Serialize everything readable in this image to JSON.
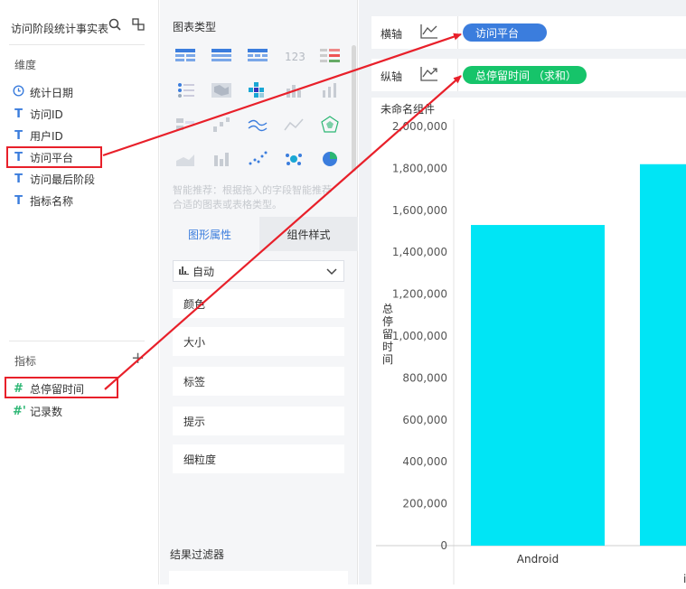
{
  "left_panel": {
    "dataset_name": "访问阶段统计事实表",
    "dimension_section": "维度",
    "dimension_fields": [
      {
        "icon": "clock",
        "label": "统计日期"
      },
      {
        "icon": "T",
        "label": "访问ID"
      },
      {
        "icon": "T",
        "label": "用户ID"
      },
      {
        "icon": "T",
        "label": "访问平台"
      },
      {
        "icon": "T",
        "label": "访问最后阶段"
      },
      {
        "icon": "T",
        "label": "指标名称"
      }
    ],
    "measure_section": "指标",
    "measure_fields": [
      {
        "icon": "#",
        "label": "总停留时间"
      },
      {
        "icon": "#'",
        "label": "记录数"
      }
    ]
  },
  "middle_panel": {
    "chart_type_title": "图表类型",
    "smart_hint": "智能推荐：根据拖入的字段智能推荐合适的图表或表格类型。",
    "tabs": [
      "图形属性",
      "组件样式"
    ],
    "shape_select": "自动",
    "attributes": [
      "颜色",
      "大小",
      "标签",
      "提示",
      "细粒度"
    ],
    "result_filter_title": "结果过滤器"
  },
  "right_panel": {
    "x_axis_label": "横轴",
    "x_axis_field": "访问平台",
    "y_axis_label": "纵轴",
    "y_axis_field": "总停留时间 （求和）",
    "component_title": "未命名组件"
  },
  "colors": {
    "accent_blue": "#3b7ddd",
    "accent_green": "#16c46a",
    "bar_cyan": "#00e5f5",
    "annotation_red": "#e8202a"
  },
  "chart_data": {
    "type": "bar",
    "categories": [
      "Android",
      "i"
    ],
    "values": [
      1530000,
      1820000
    ],
    "ylabel": "总停留时间",
    "yticks": [
      "0",
      "200,000",
      "400,000",
      "600,000",
      "800,000",
      "1,000,000",
      "1,200,000",
      "1,400,000",
      "1,600,000",
      "1,800,000",
      "2,000,000"
    ],
    "ylim": [
      0,
      2000000
    ],
    "grid": false
  }
}
